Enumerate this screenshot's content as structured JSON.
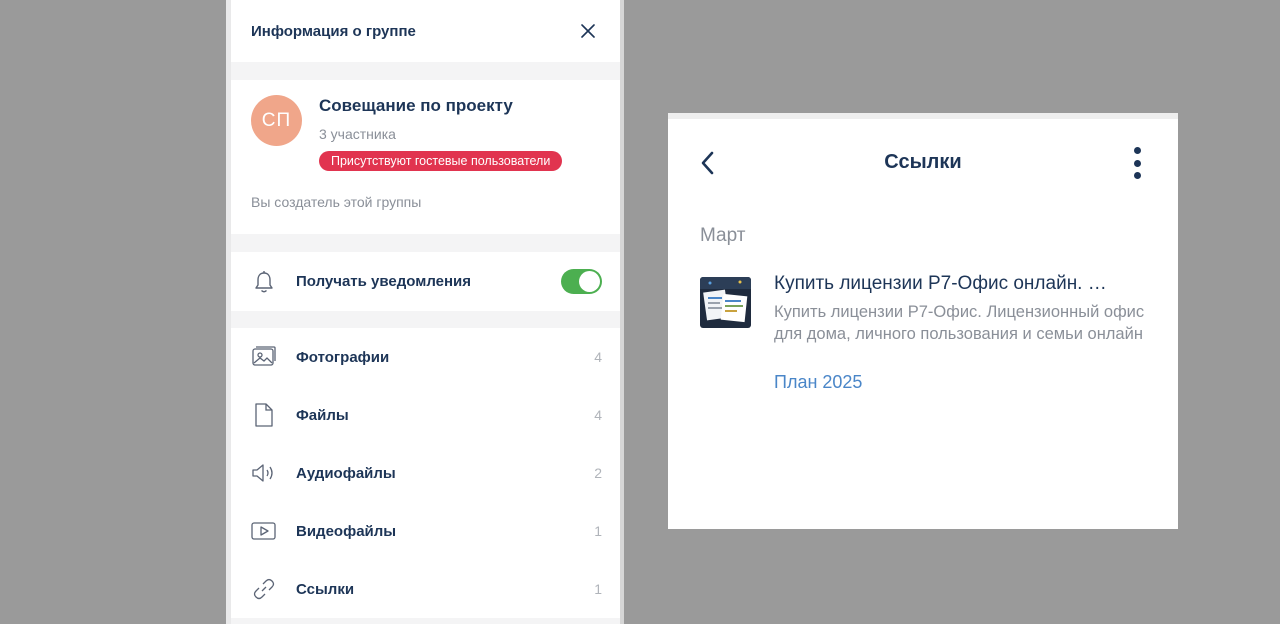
{
  "left_panel": {
    "title": "Информация о группе",
    "group": {
      "avatar_initials": "СП",
      "avatar_color": "#f0a68a",
      "name": "Совещание по проекту",
      "members": "3 участника",
      "guest_badge": "Присутствуют гостевые пользователи",
      "creator_note": "Вы создатель этой группы"
    },
    "notifications": {
      "label": "Получать уведомления",
      "enabled": true
    },
    "media": [
      {
        "label": "Фотографии",
        "count": "4",
        "icon": "photo-icon"
      },
      {
        "label": "Файлы",
        "count": "4",
        "icon": "file-icon"
      },
      {
        "label": "Аудиофайлы",
        "count": "2",
        "icon": "audio-icon"
      },
      {
        "label": "Видеофайлы",
        "count": "1",
        "icon": "video-icon"
      },
      {
        "label": "Ссылки",
        "count": "1",
        "icon": "link-icon"
      }
    ]
  },
  "right_panel": {
    "title": "Ссылки",
    "month": "Март",
    "link": {
      "title": "Купить лицензии Р7-Офис онлайн. …",
      "description": "Купить лицензии Р7-Офис. Лицензионный офис для дома, личного пользования и семьи онлайн",
      "chat": "План 2025"
    }
  },
  "colors": {
    "accent_text": "#1d3557",
    "toggle_on": "#4caf50",
    "guest_badge": "#e1344f",
    "link_blue": "#4a86c8"
  }
}
